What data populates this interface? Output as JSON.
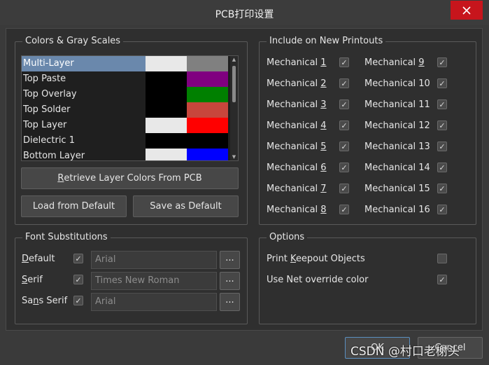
{
  "window": {
    "title": "PCB打印设置",
    "close_icon": "close-icon"
  },
  "colors_group": {
    "legend": "Colors & Gray Scales",
    "layers": [
      {
        "name": "Multi-Layer",
        "selected": true,
        "color": "#e8e8e8",
        "gray": "#808080"
      },
      {
        "name": "Top Paste",
        "selected": false,
        "color": "#000000",
        "gray": "#800080"
      },
      {
        "name": "Top Overlay",
        "selected": false,
        "color": "#000000",
        "gray": "#008000"
      },
      {
        "name": "Top Solder",
        "selected": false,
        "color": "#000000",
        "gray": "#c8463c"
      },
      {
        "name": "Top Layer",
        "selected": false,
        "color": "#e8e8e8",
        "gray": "#ff0000"
      },
      {
        "name": "Dielectric 1",
        "selected": false,
        "color": "#000000",
        "gray": "#000000"
      },
      {
        "name": "Bottom Layer",
        "selected": false,
        "color": "#e8e8e8",
        "gray": "#0000ff"
      }
    ],
    "retrieve_button": {
      "hotkey": "R",
      "rest": "etrieve Layer Colors From PCB"
    },
    "load_default_button": "Load from Default",
    "save_default_button": "Save as Default"
  },
  "printouts_group": {
    "legend": "Include on New Printouts",
    "mechanicals": [
      {
        "prefix": "Mechanical ",
        "num": "1",
        "underline": true,
        "checked": true
      },
      {
        "prefix": "Mechanical ",
        "num": "2",
        "underline": true,
        "checked": true
      },
      {
        "prefix": "Mechanical ",
        "num": "3",
        "underline": true,
        "checked": true
      },
      {
        "prefix": "Mechanical ",
        "num": "4",
        "underline": true,
        "checked": true
      },
      {
        "prefix": "Mechanical ",
        "num": "5",
        "underline": true,
        "checked": true
      },
      {
        "prefix": "Mechanical ",
        "num": "6",
        "underline": true,
        "checked": true
      },
      {
        "prefix": "Mechanical ",
        "num": "7",
        "underline": true,
        "checked": true
      },
      {
        "prefix": "Mechanical ",
        "num": "8",
        "underline": true,
        "checked": true
      },
      {
        "prefix": "Mechanical ",
        "num": "9",
        "underline": true,
        "checked": true
      },
      {
        "prefix": "Mechanical ",
        "num": "10",
        "underline": false,
        "checked": true
      },
      {
        "prefix": "Mechanical ",
        "num": "11",
        "underline": false,
        "checked": true
      },
      {
        "prefix": "Mechanical ",
        "num": "12",
        "underline": false,
        "checked": true
      },
      {
        "prefix": "Mechanical ",
        "num": "13",
        "underline": false,
        "checked": true
      },
      {
        "prefix": "Mechanical ",
        "num": "14",
        "underline": false,
        "checked": true
      },
      {
        "prefix": "Mechanical ",
        "num": "15",
        "underline": false,
        "checked": true
      },
      {
        "prefix": "Mechanical ",
        "num": "16",
        "underline": false,
        "checked": true
      }
    ]
  },
  "fonts_group": {
    "legend": "Font Substitutions",
    "rows": [
      {
        "label_pre": "",
        "label_hot": "D",
        "label_post": "efault",
        "checked": true,
        "font": "Arial"
      },
      {
        "label_pre": "",
        "label_hot": "S",
        "label_post": "erif",
        "checked": true,
        "font": "Times New Roman"
      },
      {
        "label_pre": "Sa",
        "label_hot": "n",
        "label_post": "s Serif",
        "checked": true,
        "font": "Arial"
      }
    ],
    "browse_label": "..."
  },
  "options_group": {
    "legend": "Options",
    "print_keepout": {
      "pre": "Print ",
      "hot": "K",
      "post": "eepout Objects",
      "checked": false
    },
    "net_override": {
      "label": "Use Net override color",
      "checked": true
    }
  },
  "footer": {
    "ok_label": "OK",
    "cancel_label": "Cancel",
    "watermark": "CSDN @村口老榭头"
  },
  "check_glyph": "✓"
}
